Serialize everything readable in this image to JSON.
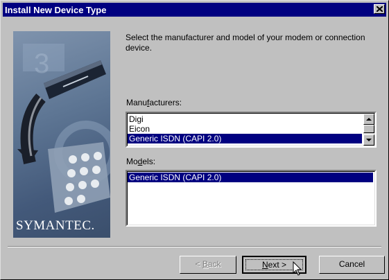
{
  "window": {
    "title": "Install New Device Type"
  },
  "sidebar": {
    "brand": "SYMANTEC."
  },
  "intro": "Select the manufacturer and model of your modem or connection device.",
  "manufacturers": {
    "label_pre": "Manu",
    "label_key": "f",
    "label_post": "acturers:",
    "items": [
      "Digi",
      "Eicon",
      "Generic ISDN (CAPI 2.0)"
    ],
    "selected": "Generic ISDN (CAPI 2.0)"
  },
  "models": {
    "label_pre": "Mo",
    "label_key": "d",
    "label_post": "els:",
    "items": [
      "Generic ISDN (CAPI 2.0)"
    ],
    "selected": "Generic ISDN (CAPI 2.0)"
  },
  "buttons": {
    "back_pre": "< ",
    "back_key": "B",
    "back_post": "ack",
    "next_key": "N",
    "next_post": "ext >",
    "cancel": "Cancel"
  },
  "colors": {
    "titlebar": "#000080",
    "selection": "#000080",
    "face": "#c0c0c0"
  },
  "icons": [
    "close-icon",
    "scroll-up-arrow-icon",
    "scroll-down-arrow-icon",
    "mouse-pointer-icon"
  ]
}
